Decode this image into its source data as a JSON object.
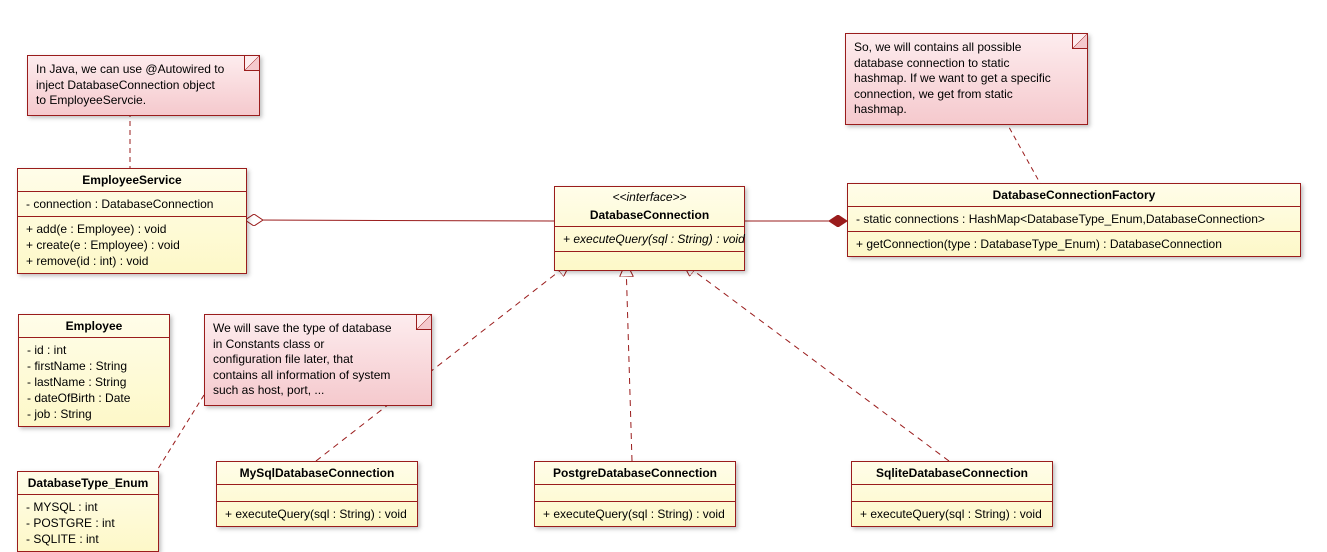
{
  "notes": {
    "note1": {
      "l1": "In Java, we can use @Autowired to",
      "l2": "inject DatabaseConnection object",
      "l3": "to EmployeeServcie."
    },
    "note2": {
      "l1": "We will save the type of database",
      "l2": "in Constants class or",
      "l3": "configuration file later, that",
      "l4": "contains all information of system",
      "l5": "such as host, port, ..."
    },
    "note3": {
      "l1": "So, we will contains all possible",
      "l2": "database connection to static",
      "l3": "hashmap. If we want to get a specific",
      "l4": "connection, we get from static",
      "l5": "hashmap."
    }
  },
  "classes": {
    "employeeService": {
      "name": "EmployeeService",
      "attrs": {
        "a1": "- connection : DatabaseConnection"
      },
      "ops": {
        "o1": "+ add(e : Employee) : void",
        "o2": "+ create(e : Employee) : void",
        "o3": "+ remove(id : int) : void"
      }
    },
    "databaseConnection": {
      "stereo": "<<interface>>",
      "name": "DatabaseConnection",
      "ops": {
        "o1": "+ executeQuery(sql : String) : void"
      }
    },
    "dbFactory": {
      "name": "DatabaseConnectionFactory",
      "attrs": {
        "a1": "- static connections : HashMap<DatabaseType_Enum,DatabaseConnection>"
      },
      "ops": {
        "o1": "+ getConnection(type : DatabaseType_Enum) : DatabaseConnection"
      }
    },
    "employee": {
      "name": "Employee",
      "attrs": {
        "a1": "- id : int",
        "a2": "- firstName : String",
        "a3": "- lastName : String",
        "a4": "- dateOfBirth : Date",
        "a5": "- job : String"
      }
    },
    "dbTypeEnum": {
      "name": "DatabaseType_Enum",
      "attrs": {
        "a1": "- MYSQL : int",
        "a2": "- POSTGRE : int",
        "a3": "- SQLITE : int"
      }
    },
    "mysql": {
      "name": "MySqlDatabaseConnection",
      "ops": {
        "o1": "+ executeQuery(sql : String) : void"
      }
    },
    "postgre": {
      "name": "PostgreDatabaseConnection",
      "ops": {
        "o1": "+ executeQuery(sql : String) : void"
      }
    },
    "sqlite": {
      "name": "SqliteDatabaseConnection",
      "ops": {
        "o1": "+ executeQuery(sql : String) : void"
      }
    }
  }
}
